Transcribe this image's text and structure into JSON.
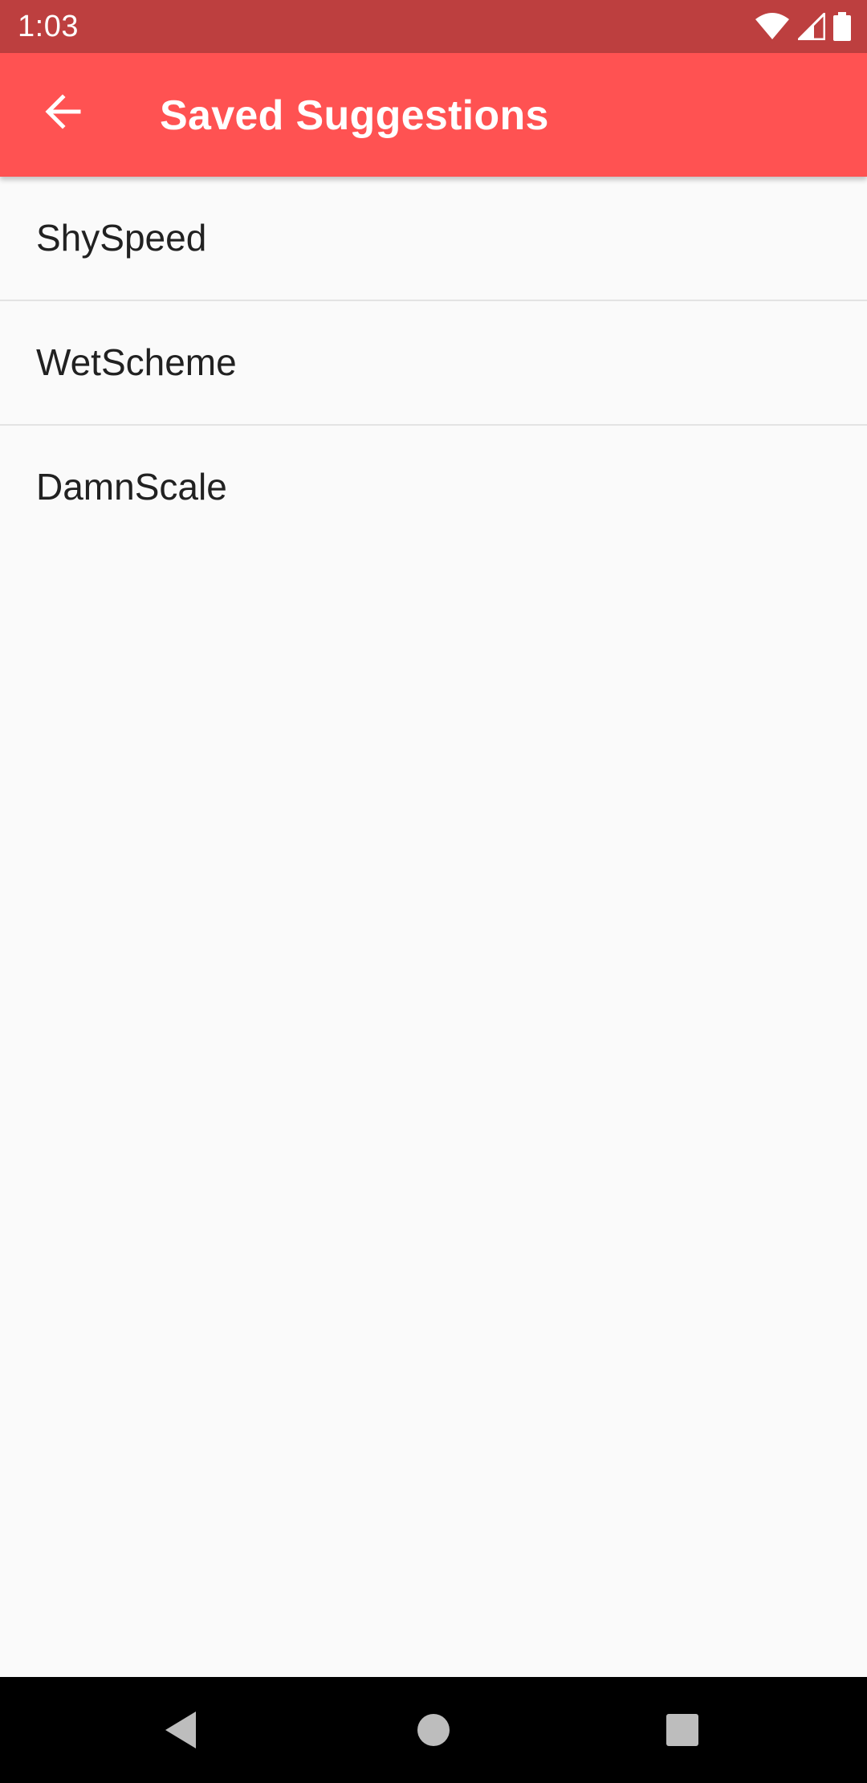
{
  "status_bar": {
    "time": "1:03",
    "icons": [
      "wifi-icon",
      "signal-icon",
      "battery-icon"
    ]
  },
  "app_bar": {
    "title": "Saved Suggestions",
    "back_icon": "arrow-back-icon",
    "background_color": "#ff5252"
  },
  "saved_list": {
    "items": [
      {
        "label": "ShySpeed"
      },
      {
        "label": "WetScheme"
      },
      {
        "label": "DamnScale"
      }
    ]
  },
  "nav_bar": {
    "buttons": [
      "back-triangle-icon",
      "home-circle-icon",
      "recents-square-icon"
    ]
  }
}
